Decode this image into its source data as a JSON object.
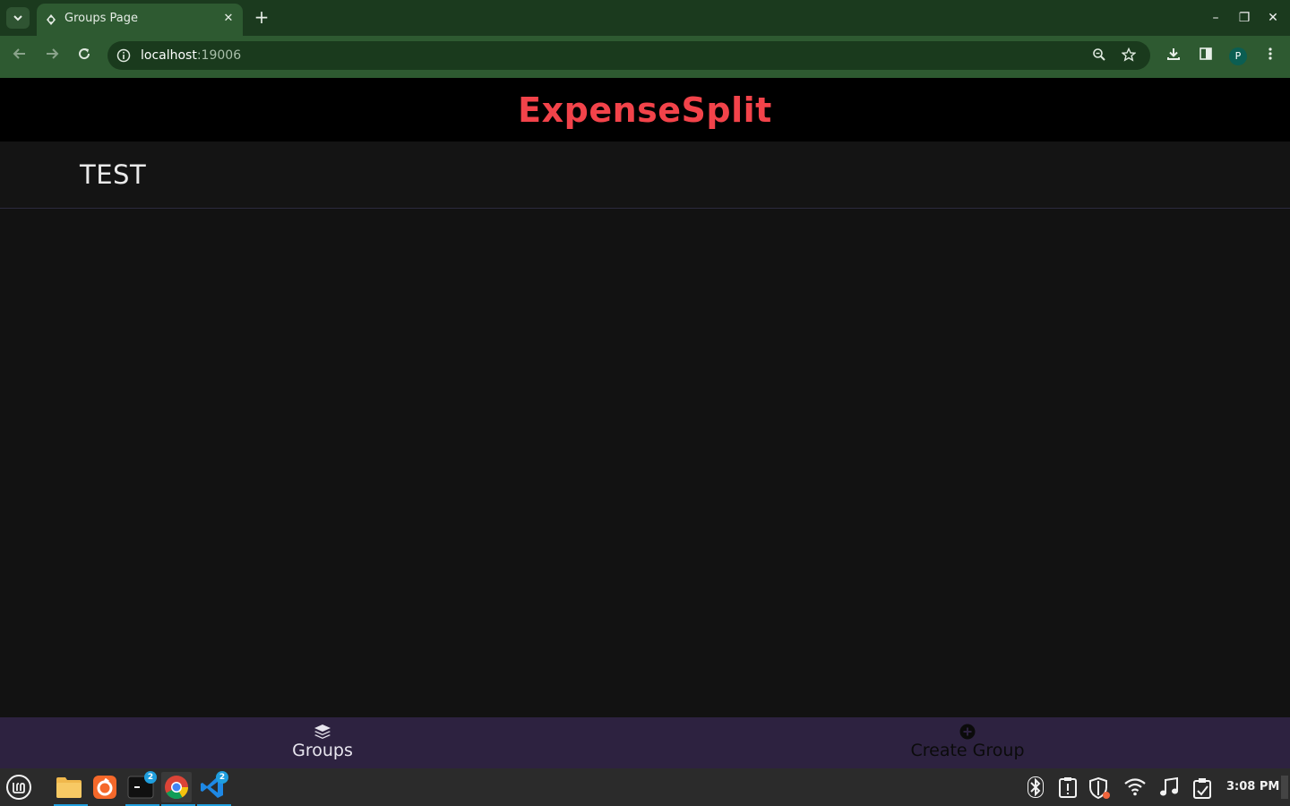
{
  "browser": {
    "tab_title": "Groups Page",
    "tab_close": "✕",
    "new_tab": "+",
    "url_host": "localhost",
    "url_port": ":19006",
    "profile_initial": "P",
    "window_controls": {
      "minimize": "–",
      "maximize": "❐",
      "close": "✕"
    }
  },
  "app": {
    "title": "ExpenseSplit",
    "title_color": "#f2434a",
    "groups": [
      {
        "name": "TEST"
      }
    ]
  },
  "bottom_nav": {
    "items": [
      {
        "label": "Groups",
        "icon": "layers-icon"
      },
      {
        "label": "Create Group",
        "icon": "plus-circle-icon"
      }
    ]
  },
  "taskbar": {
    "terminal_badge": "2",
    "vscode_badge": "2",
    "clock": "3:08 PM"
  }
}
